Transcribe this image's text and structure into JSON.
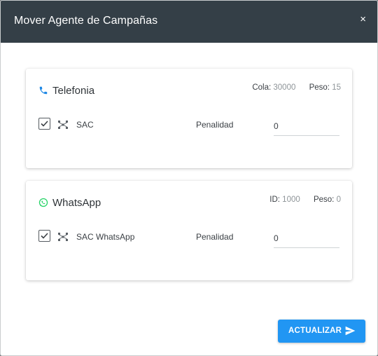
{
  "modal": {
    "title": "Mover Agente de Campañas",
    "close_label": "×"
  },
  "channels": [
    {
      "title": "Telefonia",
      "icon": "phone-icon",
      "meta": [
        {
          "label": "Cola:",
          "value": "30000"
        },
        {
          "label": "Peso:",
          "value": "15"
        }
      ],
      "row": {
        "checked": true,
        "icon": "network-icon",
        "name": "SAC",
        "penalty_label": "Penalidad",
        "penalty_value": "0"
      }
    },
    {
      "title": "WhatsApp",
      "icon": "whatsapp-icon",
      "meta": [
        {
          "label": "ID:",
          "value": "1000"
        },
        {
          "label": "Peso:",
          "value": "0"
        }
      ],
      "row": {
        "checked": true,
        "icon": "network-icon",
        "name": "SAC WhatsApp",
        "penalty_label": "Penalidad",
        "penalty_value": "0"
      }
    }
  ],
  "footer": {
    "update_label": "ACTUALIZAR",
    "update_icon": "send-icon"
  },
  "colors": {
    "header": "#343f47",
    "accent": "#2196f3",
    "whatsapp": "#25d366",
    "phone": "#1e88e5"
  }
}
